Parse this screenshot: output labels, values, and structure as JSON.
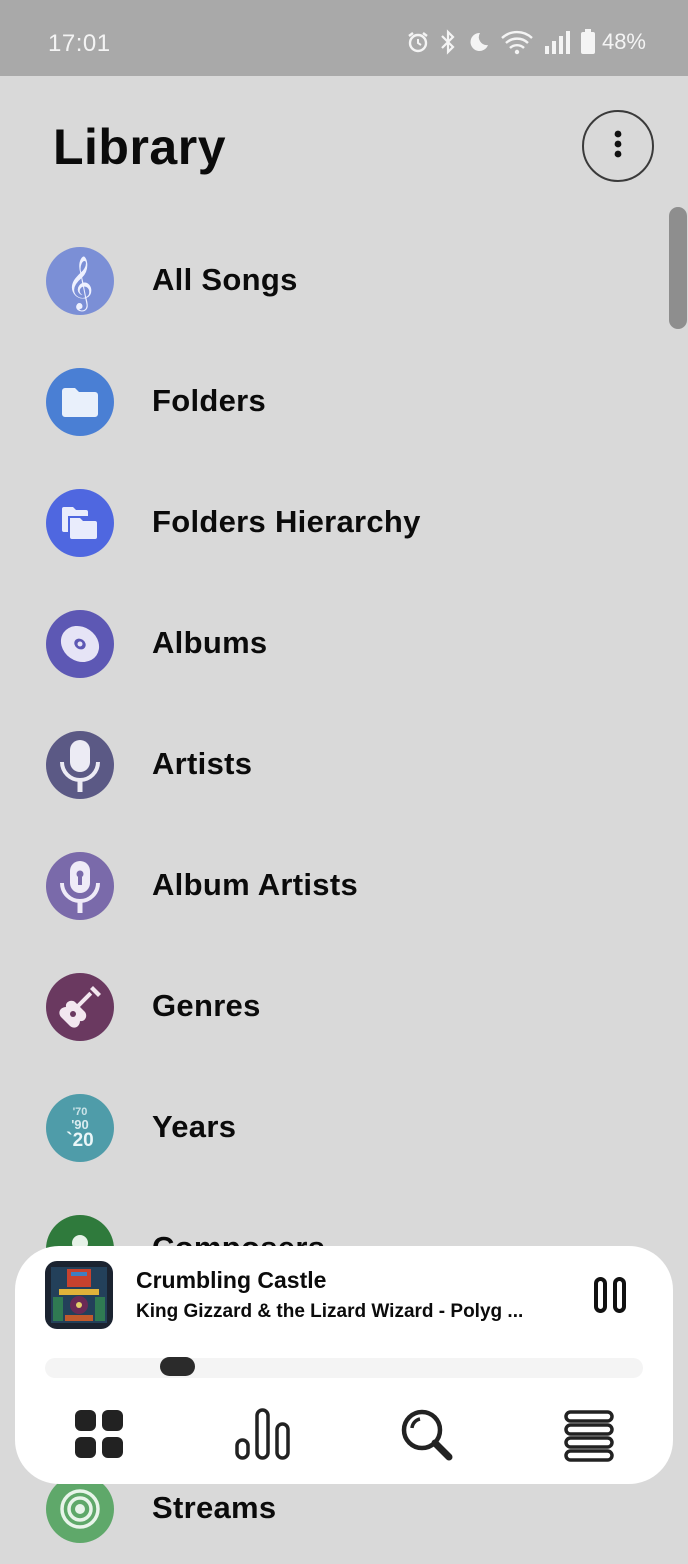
{
  "status_bar": {
    "time": "17:01",
    "battery": "48%",
    "icons": [
      "alarm-icon",
      "bluetooth-icon",
      "do-not-disturb-moon-icon",
      "wifi-icon",
      "signal-icon",
      "battery-icon"
    ]
  },
  "header": {
    "title": "Library",
    "more_icon": "more-vertical-icon"
  },
  "library": {
    "items": [
      {
        "label": "All Songs",
        "icon": "treble-clef-icon",
        "color": "#7b8fd6"
      },
      {
        "label": "Folders",
        "icon": "folder-icon",
        "color": "#4a7fd4"
      },
      {
        "label": "Folders Hierarchy",
        "icon": "folder-hierarchy-icon",
        "color": "#4f67e0"
      },
      {
        "label": "Albums",
        "icon": "album-disc-icon",
        "color": "#5d58b4"
      },
      {
        "label": "Artists",
        "icon": "microphone-icon",
        "color": "#5b5985"
      },
      {
        "label": "Album Artists",
        "icon": "podcast-mic-icon",
        "color": "#7a6aaa"
      },
      {
        "label": "Genres",
        "icon": "guitar-icon",
        "color": "#6a3960"
      },
      {
        "label": "Years",
        "icon": "years-icon",
        "color": "#4f9ca9",
        "badge_lines": [
          "'70",
          "'90",
          "`20"
        ]
      },
      {
        "label": "Composers",
        "icon": "composer-icon",
        "color": "#2f7a3c"
      },
      {
        "label": "Streams",
        "icon": "streams-icon",
        "color": "#5fa86a"
      }
    ]
  },
  "now_playing": {
    "title": "Crumbling Castle",
    "subtitle": "King Gizzard & the Lizard Wizard - Polyg ...",
    "progress": 0.2
  },
  "bottom_nav": {
    "items": [
      {
        "name": "library",
        "icon": "grid-icon"
      },
      {
        "name": "charts",
        "icon": "bar-chart-icon"
      },
      {
        "name": "search",
        "icon": "search-icon"
      },
      {
        "name": "queue",
        "icon": "menu-lines-icon"
      }
    ]
  }
}
